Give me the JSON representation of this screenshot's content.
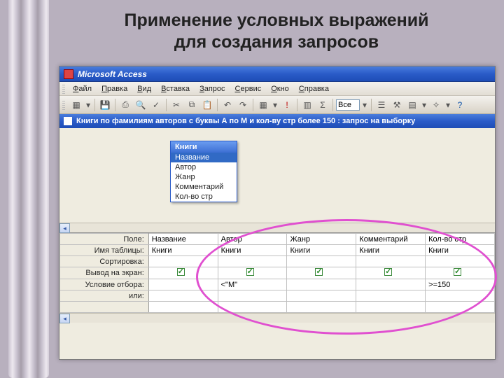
{
  "slide": {
    "title_line1": "Применение условных выражений",
    "title_line2": "для создания запросов"
  },
  "app": {
    "title": "Microsoft Access"
  },
  "menu": [
    "Файл",
    "Правка",
    "Вид",
    "Вставка",
    "Запрос",
    "Сервис",
    "Окно",
    "Справка"
  ],
  "toolbar": {
    "sigma": "Σ",
    "zoom_value": "Все"
  },
  "query_window": {
    "title": "Книги по фамилиям авторов с буквы А по М и кол-ву стр более 150 : запрос на выборку"
  },
  "table_card": {
    "name": "Книги",
    "fields": [
      "Название",
      "Автор",
      "Жанр",
      "Комментарий",
      "Кол-во стр"
    ],
    "selected": "Название"
  },
  "grid": {
    "row_labels": {
      "field": "Поле:",
      "table": "Имя таблицы:",
      "sort": "Сортировка:",
      "show": "Вывод на экран:",
      "criteria": "Условие отбора:",
      "or": "или:"
    },
    "columns": [
      {
        "field": "Название",
        "table": "Книги",
        "show": true,
        "criteria": ""
      },
      {
        "field": "Автор",
        "table": "Книги",
        "show": true,
        "criteria": "<\"М\""
      },
      {
        "field": "Жанр",
        "table": "Книги",
        "show": true,
        "criteria": ""
      },
      {
        "field": "Комментарий",
        "table": "Книги",
        "show": true,
        "criteria": ""
      },
      {
        "field": "Кол-во стр",
        "table": "Книги",
        "show": true,
        "criteria": ">=150"
      }
    ]
  }
}
